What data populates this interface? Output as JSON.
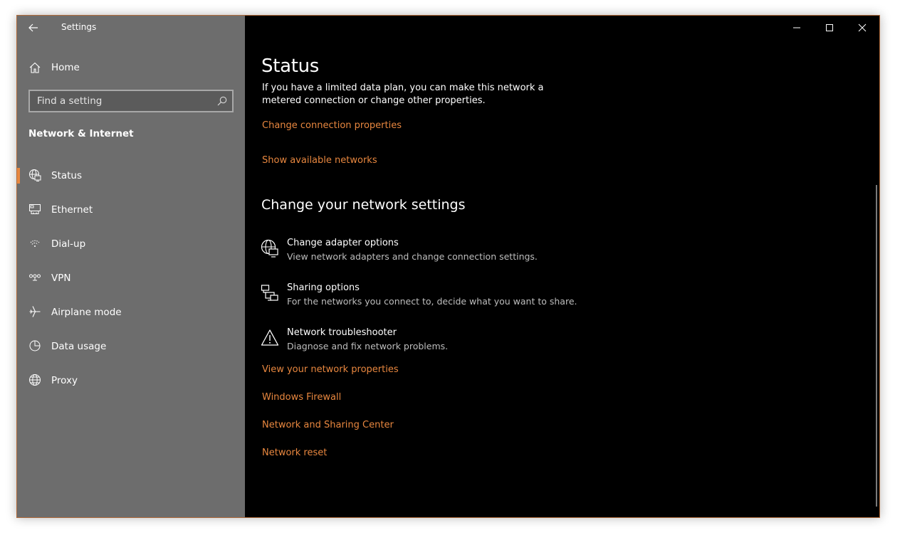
{
  "window": {
    "title": "Settings"
  },
  "sidebar": {
    "home_label": "Home",
    "search_placeholder": "Find a setting",
    "section_title": "Network & Internet",
    "items": [
      {
        "label": "Status",
        "icon": "globe-status-icon",
        "selected": true
      },
      {
        "label": "Ethernet",
        "icon": "ethernet-icon",
        "selected": false
      },
      {
        "label": "Dial-up",
        "icon": "dial-up-icon",
        "selected": false
      },
      {
        "label": "VPN",
        "icon": "vpn-icon",
        "selected": false
      },
      {
        "label": "Airplane mode",
        "icon": "airplane-icon",
        "selected": false
      },
      {
        "label": "Data usage",
        "icon": "data-usage-icon",
        "selected": false
      },
      {
        "label": "Proxy",
        "icon": "proxy-globe-icon",
        "selected": false
      }
    ]
  },
  "main": {
    "title": "Status",
    "description": "If you have a limited data plan, you can make this network a metered connection or change other properties.",
    "links_top": {
      "change_connection": "Change connection properties",
      "show_networks": "Show available networks"
    },
    "change_heading": "Change your network settings",
    "options": [
      {
        "title": "Change adapter options",
        "subtitle": "View network adapters and change connection settings.",
        "icon": "adapter-icon"
      },
      {
        "title": "Sharing options",
        "subtitle": "For the networks you connect to, decide what you want to share.",
        "icon": "sharing-icon"
      },
      {
        "title": "Network troubleshooter",
        "subtitle": "Diagnose and fix network problems.",
        "icon": "warning-icon"
      }
    ],
    "links_bottom": {
      "view_properties": "View your network properties",
      "firewall": "Windows Firewall",
      "sharing_center": "Network and Sharing Center",
      "reset": "Network reset"
    }
  },
  "colors": {
    "accent": "#e8873f",
    "sidebar_bg": "#6d6d6d",
    "content_bg": "#000000"
  }
}
